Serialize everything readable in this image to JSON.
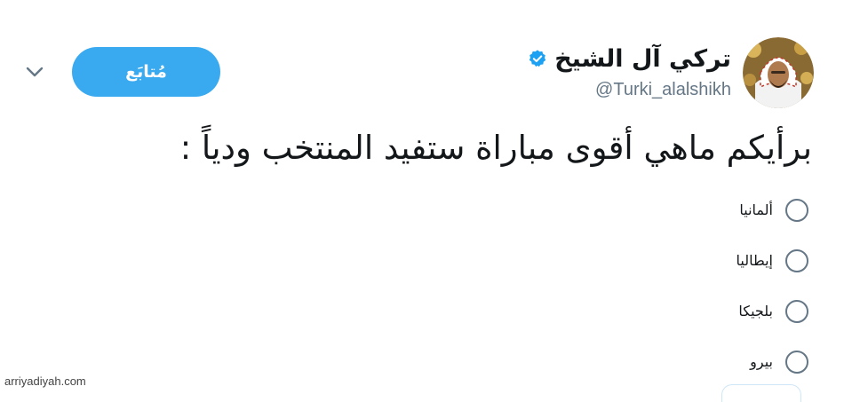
{
  "tweet": {
    "display_name": "تركي آل الشيخ",
    "handle": "@Turki_alalshikh",
    "verified_icon": "verified-badge-icon",
    "follow_label": "مُتابَع",
    "menu_icon": "chevron-down-icon",
    "avatar_icon": "user-avatar",
    "question": "برأيكم ماهي أقوى مباراة  ستفيد المنتخب ودياً :"
  },
  "poll": {
    "options": [
      {
        "label": "ألمانيا"
      },
      {
        "label": "إيطاليا"
      },
      {
        "label": "بلجيكا"
      },
      {
        "label": "بيرو"
      }
    ]
  },
  "footer": {
    "watermark": "arriyadiyah.com"
  },
  "colors": {
    "accent": "#3aaaf0",
    "verified": "#1da1f2",
    "text": "#14171a",
    "secondary": "#657786"
  }
}
